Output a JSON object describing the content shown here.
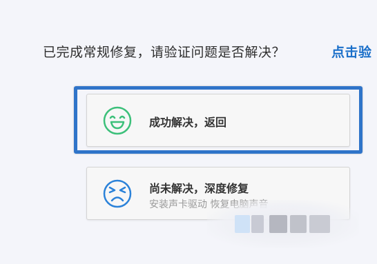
{
  "prompt": {
    "text": "已完成常规修复，请验证问题是否解决？",
    "link": "点击验"
  },
  "options": [
    {
      "title": "成功解决，返回",
      "icon": "smiley-face-icon",
      "color": "#3cc07a"
    },
    {
      "title": "尚未解决，深度修复",
      "subtitle": "安装声卡驱动  恢复电脑声音",
      "icon": "sad-face-icon",
      "color": "#2b82d9"
    }
  ],
  "highlight_color": "#2f74c9"
}
